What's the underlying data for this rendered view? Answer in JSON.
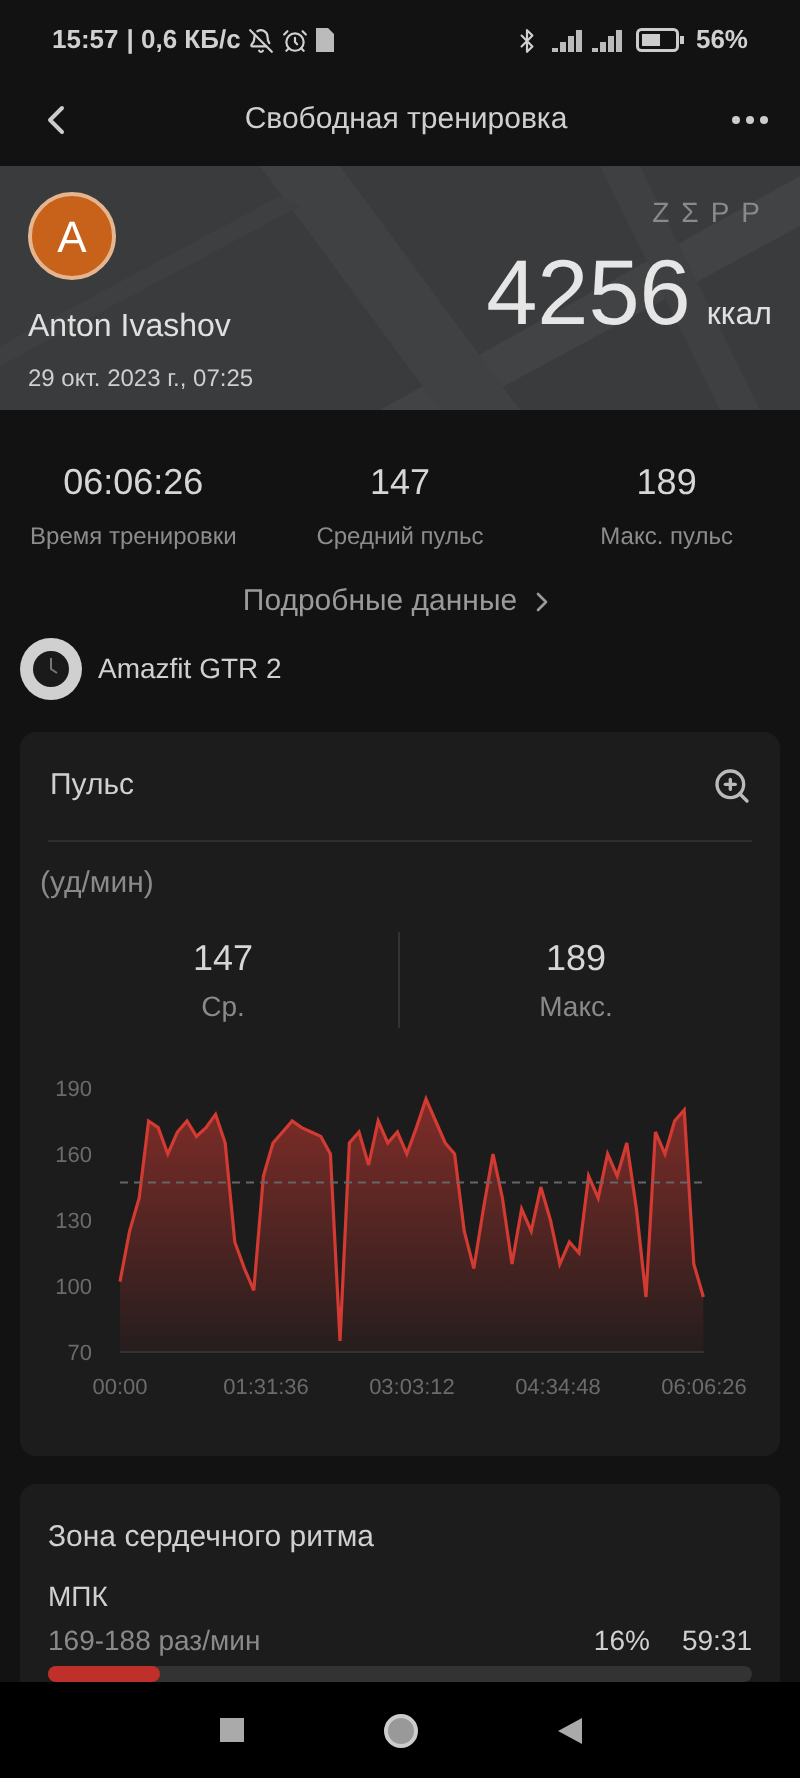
{
  "status_bar": {
    "time": "15:57",
    "speed": "| 0,6 КБ/с",
    "battery": "56%"
  },
  "header": {
    "title": "Свободная тренировка"
  },
  "hero": {
    "avatar_letter": "A",
    "brand": "ZΣPP",
    "name": "Anton Ivashov",
    "date": "29 окт. 2023 г., 07:25",
    "calories": "4256",
    "calories_unit": "ккал"
  },
  "stats": [
    {
      "value": "06:06:26",
      "label": "Время тренировки"
    },
    {
      "value": "147",
      "label": "Средний пульс"
    },
    {
      "value": "189",
      "label": "Макс. пульс"
    }
  ],
  "details_link": "Подробные данные",
  "device": {
    "name": "Amazfit GTR 2"
  },
  "pulse_card": {
    "title": "Пульс",
    "unit": "(уд/мин)",
    "summary": [
      {
        "value": "147",
        "label": "Ср."
      },
      {
        "value": "189",
        "label": "Макс."
      }
    ],
    "chart_data": {
      "type": "area",
      "ylim": [
        70,
        190
      ],
      "yticks": [
        70,
        100,
        130,
        160,
        190
      ],
      "xlim": [
        0,
        21986
      ],
      "xticks": [
        {
          "value": 0,
          "label": "00:00"
        },
        {
          "value": 5496,
          "label": "01:31:36"
        },
        {
          "value": 10992,
          "label": "03:03:12"
        },
        {
          "value": 16488,
          "label": "04:34:48"
        },
        {
          "value": 21986,
          "label": "06:06:26"
        }
      ],
      "x": [
        0,
        360,
        720,
        1080,
        1440,
        1800,
        2160,
        2520,
        2880,
        3240,
        3600,
        3960,
        4320,
        4680,
        5040,
        5400,
        5760,
        6120,
        6480,
        6840,
        7200,
        7560,
        7920,
        8280,
        8640,
        9000,
        9360,
        9720,
        10080,
        10440,
        10800,
        11160,
        11520,
        11880,
        12240,
        12600,
        12960,
        13320,
        13680,
        14040,
        14400,
        14760,
        15120,
        15480,
        15840,
        16200,
        16560,
        16920,
        17280,
        17640,
        18000,
        18360,
        18720,
        19080,
        19440,
        19800,
        20160,
        20520,
        20880,
        21240,
        21600,
        21960
      ],
      "series": [
        {
          "color": "#d23a32",
          "values": [
            102,
            125,
            140,
            175,
            172,
            160,
            170,
            175,
            168,
            172,
            178,
            165,
            120,
            108,
            98,
            150,
            165,
            170,
            175,
            172,
            170,
            168,
            160,
            75,
            165,
            170,
            155,
            175,
            165,
            170,
            160,
            172,
            185,
            175,
            165,
            160,
            125,
            108,
            135,
            160,
            140,
            110,
            135,
            125,
            145,
            130,
            110,
            120,
            115,
            150,
            140,
            160,
            150,
            165,
            135,
            95,
            170,
            160,
            175,
            180,
            110,
            95
          ]
        },
        {
          "type": "line",
          "line_style": "dashed",
          "color": "#666666",
          "values": [
            147,
            147,
            147,
            147,
            147,
            147,
            147,
            147,
            147,
            147,
            147,
            147,
            147,
            147,
            147,
            147,
            147,
            147,
            147,
            147,
            147,
            147,
            147,
            147,
            147,
            147,
            147,
            147,
            147,
            147,
            147,
            147,
            147,
            147,
            147,
            147,
            147,
            147,
            147,
            147,
            147,
            147,
            147,
            147,
            147,
            147,
            147,
            147,
            147,
            147,
            147,
            147,
            147,
            147,
            147,
            147,
            147,
            147,
            147,
            147,
            147,
            147
          ]
        }
      ]
    }
  },
  "zone_card": {
    "title": "Зона сердечного ритма",
    "zones": [
      {
        "name": "МПК",
        "range": "169-188 раз/мин",
        "percent": "16%",
        "duration": "59:31",
        "level": 0.16
      }
    ]
  }
}
